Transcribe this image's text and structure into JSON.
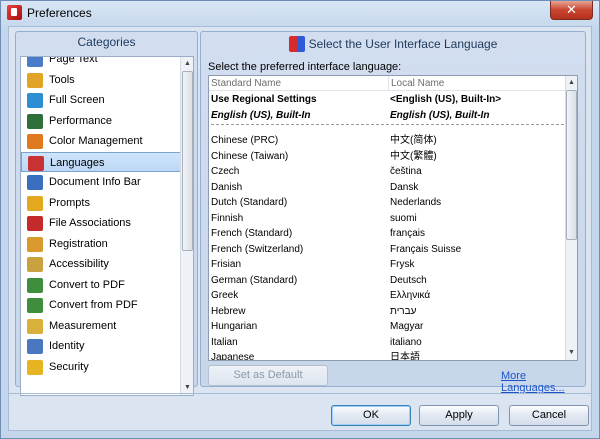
{
  "window": {
    "title": "Preferences",
    "close_glyph": "✕"
  },
  "categories": {
    "header": "Categories",
    "items": [
      {
        "label": "Page Text",
        "icon": "page-text-icon",
        "color": "#4a7bc8"
      },
      {
        "label": "Tools",
        "icon": "tools-icon",
        "color": "#e0a526"
      },
      {
        "label": "Full Screen",
        "icon": "full-screen-icon",
        "color": "#2d8ed4"
      },
      {
        "label": "Performance",
        "icon": "performance-icon",
        "color": "#2f6f3a"
      },
      {
        "label": "Color Management",
        "icon": "color-management-icon",
        "color": "#e07a20"
      },
      {
        "label": "Languages",
        "icon": "languages-icon",
        "color": "#c83232"
      },
      {
        "label": "Document Info Bar",
        "icon": "document-info-bar-icon",
        "color": "#3a6fc0"
      },
      {
        "label": "Prompts",
        "icon": "prompts-icon",
        "color": "#e2a820"
      },
      {
        "label": "File Associations",
        "icon": "file-associations-icon",
        "color": "#c42a2a"
      },
      {
        "label": "Registration",
        "icon": "registration-icon",
        "color": "#d89a2c"
      },
      {
        "label": "Accessibility",
        "icon": "accessibility-icon",
        "color": "#c9a240"
      },
      {
        "label": "Convert to PDF",
        "icon": "convert-to-pdf-icon",
        "color": "#3e8e3e"
      },
      {
        "label": "Convert from PDF",
        "icon": "convert-from-pdf-icon",
        "color": "#3e8e3e"
      },
      {
        "label": "Measurement",
        "icon": "measurement-icon",
        "color": "#d9b13a"
      },
      {
        "label": "Identity",
        "icon": "identity-icon",
        "color": "#4a78c0"
      },
      {
        "label": "Security",
        "icon": "security-icon",
        "color": "#e6b422"
      }
    ],
    "selected": "Languages"
  },
  "language_panel": {
    "header": "Select the User Interface Language",
    "subtitle": "Select the preferred interface language:",
    "col_standard": "Standard Name",
    "col_local": "Local Name",
    "special_rows": [
      {
        "standard": "Use Regional Settings",
        "local": "<English (US), Built-In>"
      },
      {
        "standard": "English (US), Built-In",
        "local": "English (US), Built-In"
      }
    ],
    "rows": [
      {
        "standard": "Chinese (PRC)",
        "local": "中文(简体)"
      },
      {
        "standard": "Chinese (Taiwan)",
        "local": "中文(繁體)"
      },
      {
        "standard": "Czech",
        "local": "čeština"
      },
      {
        "standard": "Danish",
        "local": "Dansk"
      },
      {
        "standard": "Dutch (Standard)",
        "local": "Nederlands"
      },
      {
        "standard": "Finnish",
        "local": "suomi"
      },
      {
        "standard": "French (Standard)",
        "local": "français"
      },
      {
        "standard": "French (Switzerland)",
        "local": "Français Suisse"
      },
      {
        "standard": "Frisian",
        "local": "Frysk"
      },
      {
        "standard": "German (Standard)",
        "local": "Deutsch"
      },
      {
        "standard": "Greek",
        "local": "Ελληνικά"
      },
      {
        "standard": "Hebrew",
        "local": "עברית"
      },
      {
        "standard": "Hungarian",
        "local": "Magyar"
      },
      {
        "standard": "Italian",
        "local": "italiano"
      },
      {
        "standard": "Japanese",
        "local": "日本語"
      }
    ],
    "set_default_label": "Set as Default",
    "more_languages_label": "More Languages..."
  },
  "footer": {
    "ok_label": "OK",
    "apply_label": "Apply",
    "cancel_label": "Cancel"
  }
}
